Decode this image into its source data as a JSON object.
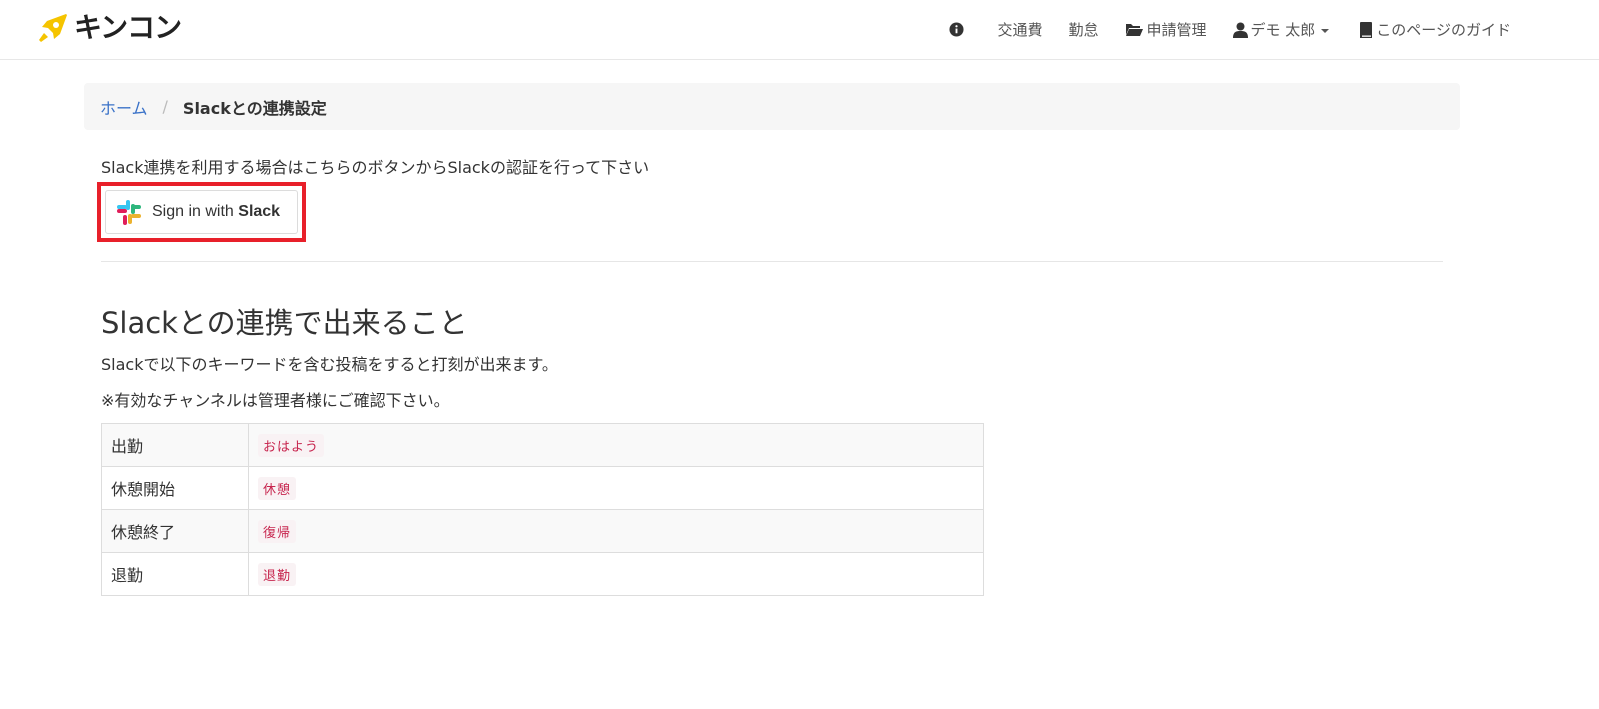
{
  "app": {
    "brand_name": "キンコン",
    "brand_color": "#f5c400"
  },
  "nav": {
    "info_icon": "info-circle-icon",
    "transport_label": "交通費",
    "attendance_label": "勤怠",
    "requests_label": "申請管理",
    "user_label": "デモ 太郎",
    "guide_label": "このページのガイド"
  },
  "breadcrumb": {
    "home_label": "ホーム",
    "separator": "/",
    "current_label": "Slackとの連携設定"
  },
  "intro": {
    "text": "Slack連携を利用する場合はこちらのボタンからSlackの認証を行って下さい"
  },
  "slack_button": {
    "prefix": "Sign in with ",
    "brand": "Slack",
    "highlight_color": "#e8202a"
  },
  "section": {
    "title": "Slackとの連携で出来ること",
    "description": "Slackで以下のキーワードを含む投稿をすると打刻が出来ます。",
    "note": "※有効なチャンネルは管理者様にご確認下さい。"
  },
  "keywords": {
    "rows": [
      {
        "action": "出勤",
        "keyword": "おはよう"
      },
      {
        "action": "休憩開始",
        "keyword": "休憩"
      },
      {
        "action": "休憩終了",
        "keyword": "復帰"
      },
      {
        "action": "退勤",
        "keyword": "退勤"
      }
    ]
  }
}
